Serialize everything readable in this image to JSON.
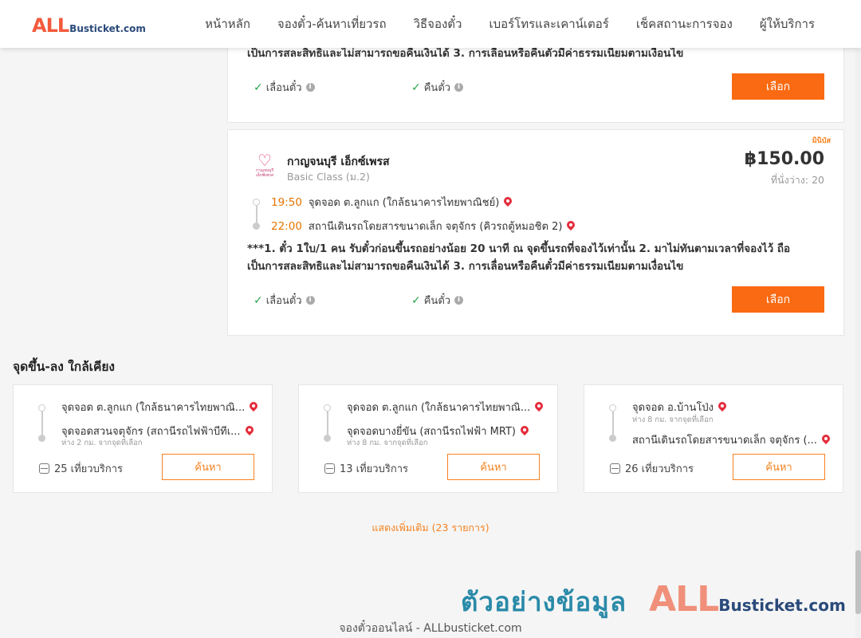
{
  "header": {
    "logo_all": "ALL",
    "logo_rest": "Busticket.com",
    "nav": [
      "หน้าหลัก",
      "จองตั๋ว-ค้นหาเที่ยวรถ",
      "วิธีจองตั๋ว",
      "เบอร์โทรและเคาน์เตอร์",
      "เช็คสถานะการจอง",
      "ผู้ให้บริการ"
    ]
  },
  "card1": {
    "note_tail": "เป็นการสละสิทธิและไม่สามารถขอคืนเงินได้ 3. การเลื่อนหรือคืนตั๋วมีค่าธรรมเนียมตามเงื่อนไข",
    "feature_change": "เลื่อนตั๋ว",
    "feature_refund": "คืนตั๋ว",
    "select_label": "เลือก"
  },
  "card2": {
    "badge": "มินิบัส",
    "operator_logo_text": "กาญจนบุรี เอ็กซ์เพรส",
    "operator_name": "กาญจนบุรี เอ็กซ์เพรส",
    "class": "Basic Class (ม.2)",
    "price": "฿150.00",
    "seats": "ที่นั่งว่าง: 20",
    "depart_time": "19:50",
    "depart_stop": "จุดจอด ต.ลูกแก (ใกล้ธนาคารไทยพาณิชย์)",
    "arrive_time": "22:00",
    "arrive_stop": "สถานีเดินรถโดยสารขนาดเล็ก จตุจักร (คิวรถตู้หมอชิต 2)",
    "note_line1": "***1. ตั๋ว 1ใบ/1 คน รับตั๋วก่อนขึ้นรถอย่างน้อย 20 นาที ณ จุดขึ้นรถที่จองไว้เท่านั้น 2. มาไม่ทันตามเวลาที่จองไว้ ถือ",
    "note_line2": "เป็นการสละสิทธิและไม่สามารถขอคืนเงินได้ 3. การเลื่อนหรือคืนตั๋วมีค่าธรรมเนียมตามเงื่อนไข",
    "feature_change": "เลื่อนตั๋ว",
    "feature_refund": "คืนตั๋ว",
    "select_label": "เลือก"
  },
  "nearby": {
    "title": "จุดขึ้น-ลง ใกล้เคียง",
    "cards": [
      {
        "from": "จุดจอด ต.ลูกแก (ใกล้ธนาคารไทยพาณิ...",
        "to": "จุดจอดสวนจตุจักร (สถานีรถไฟฟ้าบีทีเ...",
        "to_sub": "ห่าง 2 กม. จากจุดที่เลือก",
        "trips": "25 เที่ยวบริการ",
        "search_label": "ค้นหา"
      },
      {
        "from": "จุดจอด ต.ลูกแก (ใกล้ธนาคารไทยพาณิ...",
        "to": "จุดจอดบางยี่ขัน (สถานีรถไฟฟ้า MRT)",
        "to_sub": "ห่าง 8 กม. จากจุดที่เลือก",
        "trips": "13 เที่ยวบริการ",
        "search_label": "ค้นหา"
      },
      {
        "from": "จุดจอด อ.บ้านโป่ง",
        "from_sub": "ห่าง 8 กม. จากจุดที่เลือก",
        "to": "สถานีเดินรถโดยสารขนาดเล็ก จตุจักร (...",
        "trips": "26 เที่ยวบริการ",
        "search_label": "ค้นหา"
      }
    ]
  },
  "show_more": "แสดงเพิ่มเติม (23 รายการ)",
  "watermark": {
    "thai": "ตัวอย่างข้อมูล",
    "all": "ALL",
    "rest": "Busticket.com"
  },
  "footer": "จองตั๋วออนไลน์ - ALLbusticket.com",
  "colors": {
    "accent": "#f96a12",
    "time": "#e67300",
    "pin": "#e52c3b",
    "check": "#2aa44a"
  }
}
